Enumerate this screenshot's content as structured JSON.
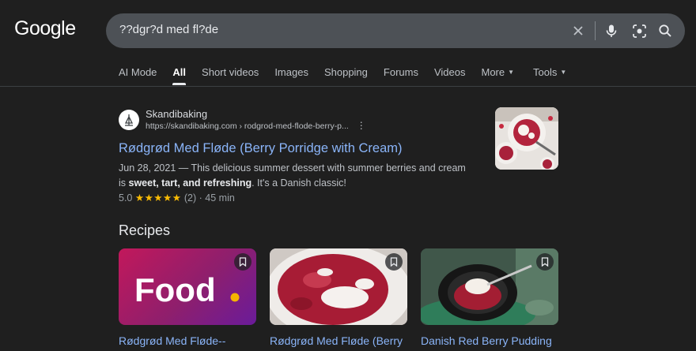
{
  "logo": {
    "text": "Google"
  },
  "search": {
    "query": "??dgr?d med fl?de"
  },
  "tabs": {
    "items": [
      {
        "label": "AI Mode"
      },
      {
        "label": "All"
      },
      {
        "label": "Short videos"
      },
      {
        "label": "Images"
      },
      {
        "label": "Shopping"
      },
      {
        "label": "Forums"
      },
      {
        "label": "Videos"
      },
      {
        "label": "More"
      }
    ],
    "tools": "Tools",
    "active": "All"
  },
  "result": {
    "site_name": "Skandibaking",
    "url": "https://skandibaking.com › rodgrod-med-flode-berry-p...",
    "title": "Rødgrød Med Fløde (Berry Porridge with Cream)",
    "snippet_date": "Jun 28, 2021",
    "snippet_text": " — This delicious summer dessert with summer berries and cream is ",
    "snippet_bold": "sweet, tart, and refreshing",
    "snippet_end": ". It's a Danish classic!",
    "rating_value": "5.0",
    "stars": "★★★★★",
    "review_count": "(2)",
    "time": "· 45 min"
  },
  "recipes": {
    "heading": "Recipes",
    "food_logo_text": "Food",
    "cards": [
      {
        "title": "Rødgrød Med Fløde--"
      },
      {
        "title": "Rødgrød Med Fløde (Berry"
      },
      {
        "title": "Danish Red Berry Pudding"
      }
    ]
  },
  "colors": {
    "background": "#1f1f1f",
    "searchbox": "#4d5156",
    "link": "#8ab4f8",
    "star": "#fbbc04",
    "food_gradient_start": "#c2185b",
    "food_gradient_end": "#6a1b9a",
    "food_dot": "#f5b400"
  }
}
